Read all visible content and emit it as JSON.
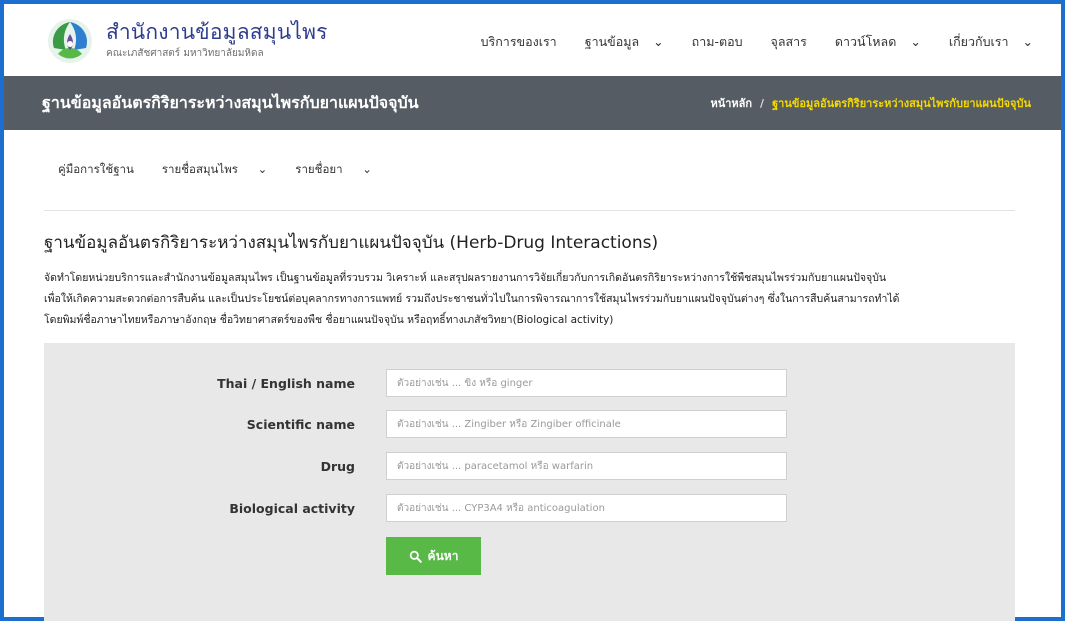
{
  "header": {
    "title": "สำนักงานข้อมูลสมุนไพร",
    "subtitle": "คณะเภสัชศาสตร์ มหาวิทยาลัยมหิดล",
    "nav": [
      {
        "label": "บริการของเรา",
        "dropdown": false
      },
      {
        "label": "ฐานข้อมูล",
        "dropdown": true
      },
      {
        "label": "ถาม-ตอบ",
        "dropdown": false
      },
      {
        "label": "จุลสาร",
        "dropdown": false
      },
      {
        "label": "ดาวน์โหลด",
        "dropdown": true
      },
      {
        "label": "เกี่ยวกับเรา",
        "dropdown": true
      }
    ]
  },
  "titlebar": {
    "title": "ฐานข้อมูลอันตรกิริยาระหว่างสมุนไพรกับยาแผนปัจจุบัน",
    "breadcrumb_home": "หน้าหลัก",
    "breadcrumb_sep": "/",
    "breadcrumb_current": "ฐานข้อมูลอันตรกิริยาระหว่างสมุนไพรกับยาแผนปัจจุบัน"
  },
  "subnav": [
    {
      "label": "คู่มือการใช้ฐาน",
      "dropdown": false
    },
    {
      "label": "รายชื่อสมุนไพร",
      "dropdown": true
    },
    {
      "label": "รายชื่อยา",
      "dropdown": true
    }
  ],
  "main": {
    "heading": "ฐานข้อมูลอันตรกิริยาระหว่างสมุนไพรกับยาแผนปัจจุบัน (Herb-Drug Interactions)",
    "description_lines": [
      "จัดทำโดยหน่วยบริการและสำนักงานข้อมูลสมุนไพร เป็นฐานข้อมูลที่รวบรวม วิเคราะห์ และสรุปผลรายงานการวิจัยเกี่ยวกับการเกิดอันตรกิริยาระหว่างการใช้พืชสมุนไพรร่วมกับยาแผนปัจจุบัน",
      "เพื่อให้เกิดความสะดวกต่อการสืบค้น และเป็นประโยชน์ต่อบุคลากรทางการแพทย์ รวมถึงประชาชนทั่วไปในการพิจารณาการใช้สมุนไพรร่วมกับยาแผนปัจจุบันต่างๆ ซึ่งในการสืบค้นสามารถทำได้",
      "โดยพิมพ์ชื่อภาษาไทยหรือภาษาอังกฤษ ชื่อวิทยาศาสตร์ของพืช ชื่อยาแผนปัจจุบัน หรือฤทธิ์ทางเภสัชวิทยา(Biological activity)"
    ]
  },
  "search": {
    "fields": [
      {
        "label": "Thai / English name",
        "placeholder": "ตัวอย่างเช่น ... ขิง หรือ ginger"
      },
      {
        "label": "Scientific name",
        "placeholder": "ตัวอย่างเช่น ... Zingiber หรือ Zingiber officinale"
      },
      {
        "label": "Drug",
        "placeholder": "ตัวอย่างเช่น ... paracetamol หรือ warfarin"
      },
      {
        "label": "Biological activity",
        "placeholder": "ตัวอย่างเช่น ... CYP3A4 หรือ anticoagulation"
      }
    ],
    "button_label": "ค้นหา",
    "button_icon": "search-icon"
  },
  "colors": {
    "border": "#1c6fcf",
    "titlebar_bg": "#555c63",
    "breadcrumb_current": "#f5d800",
    "search_bg": "#e8e8e8",
    "button": "#58b947",
    "logo_title": "#2f3d8f"
  }
}
